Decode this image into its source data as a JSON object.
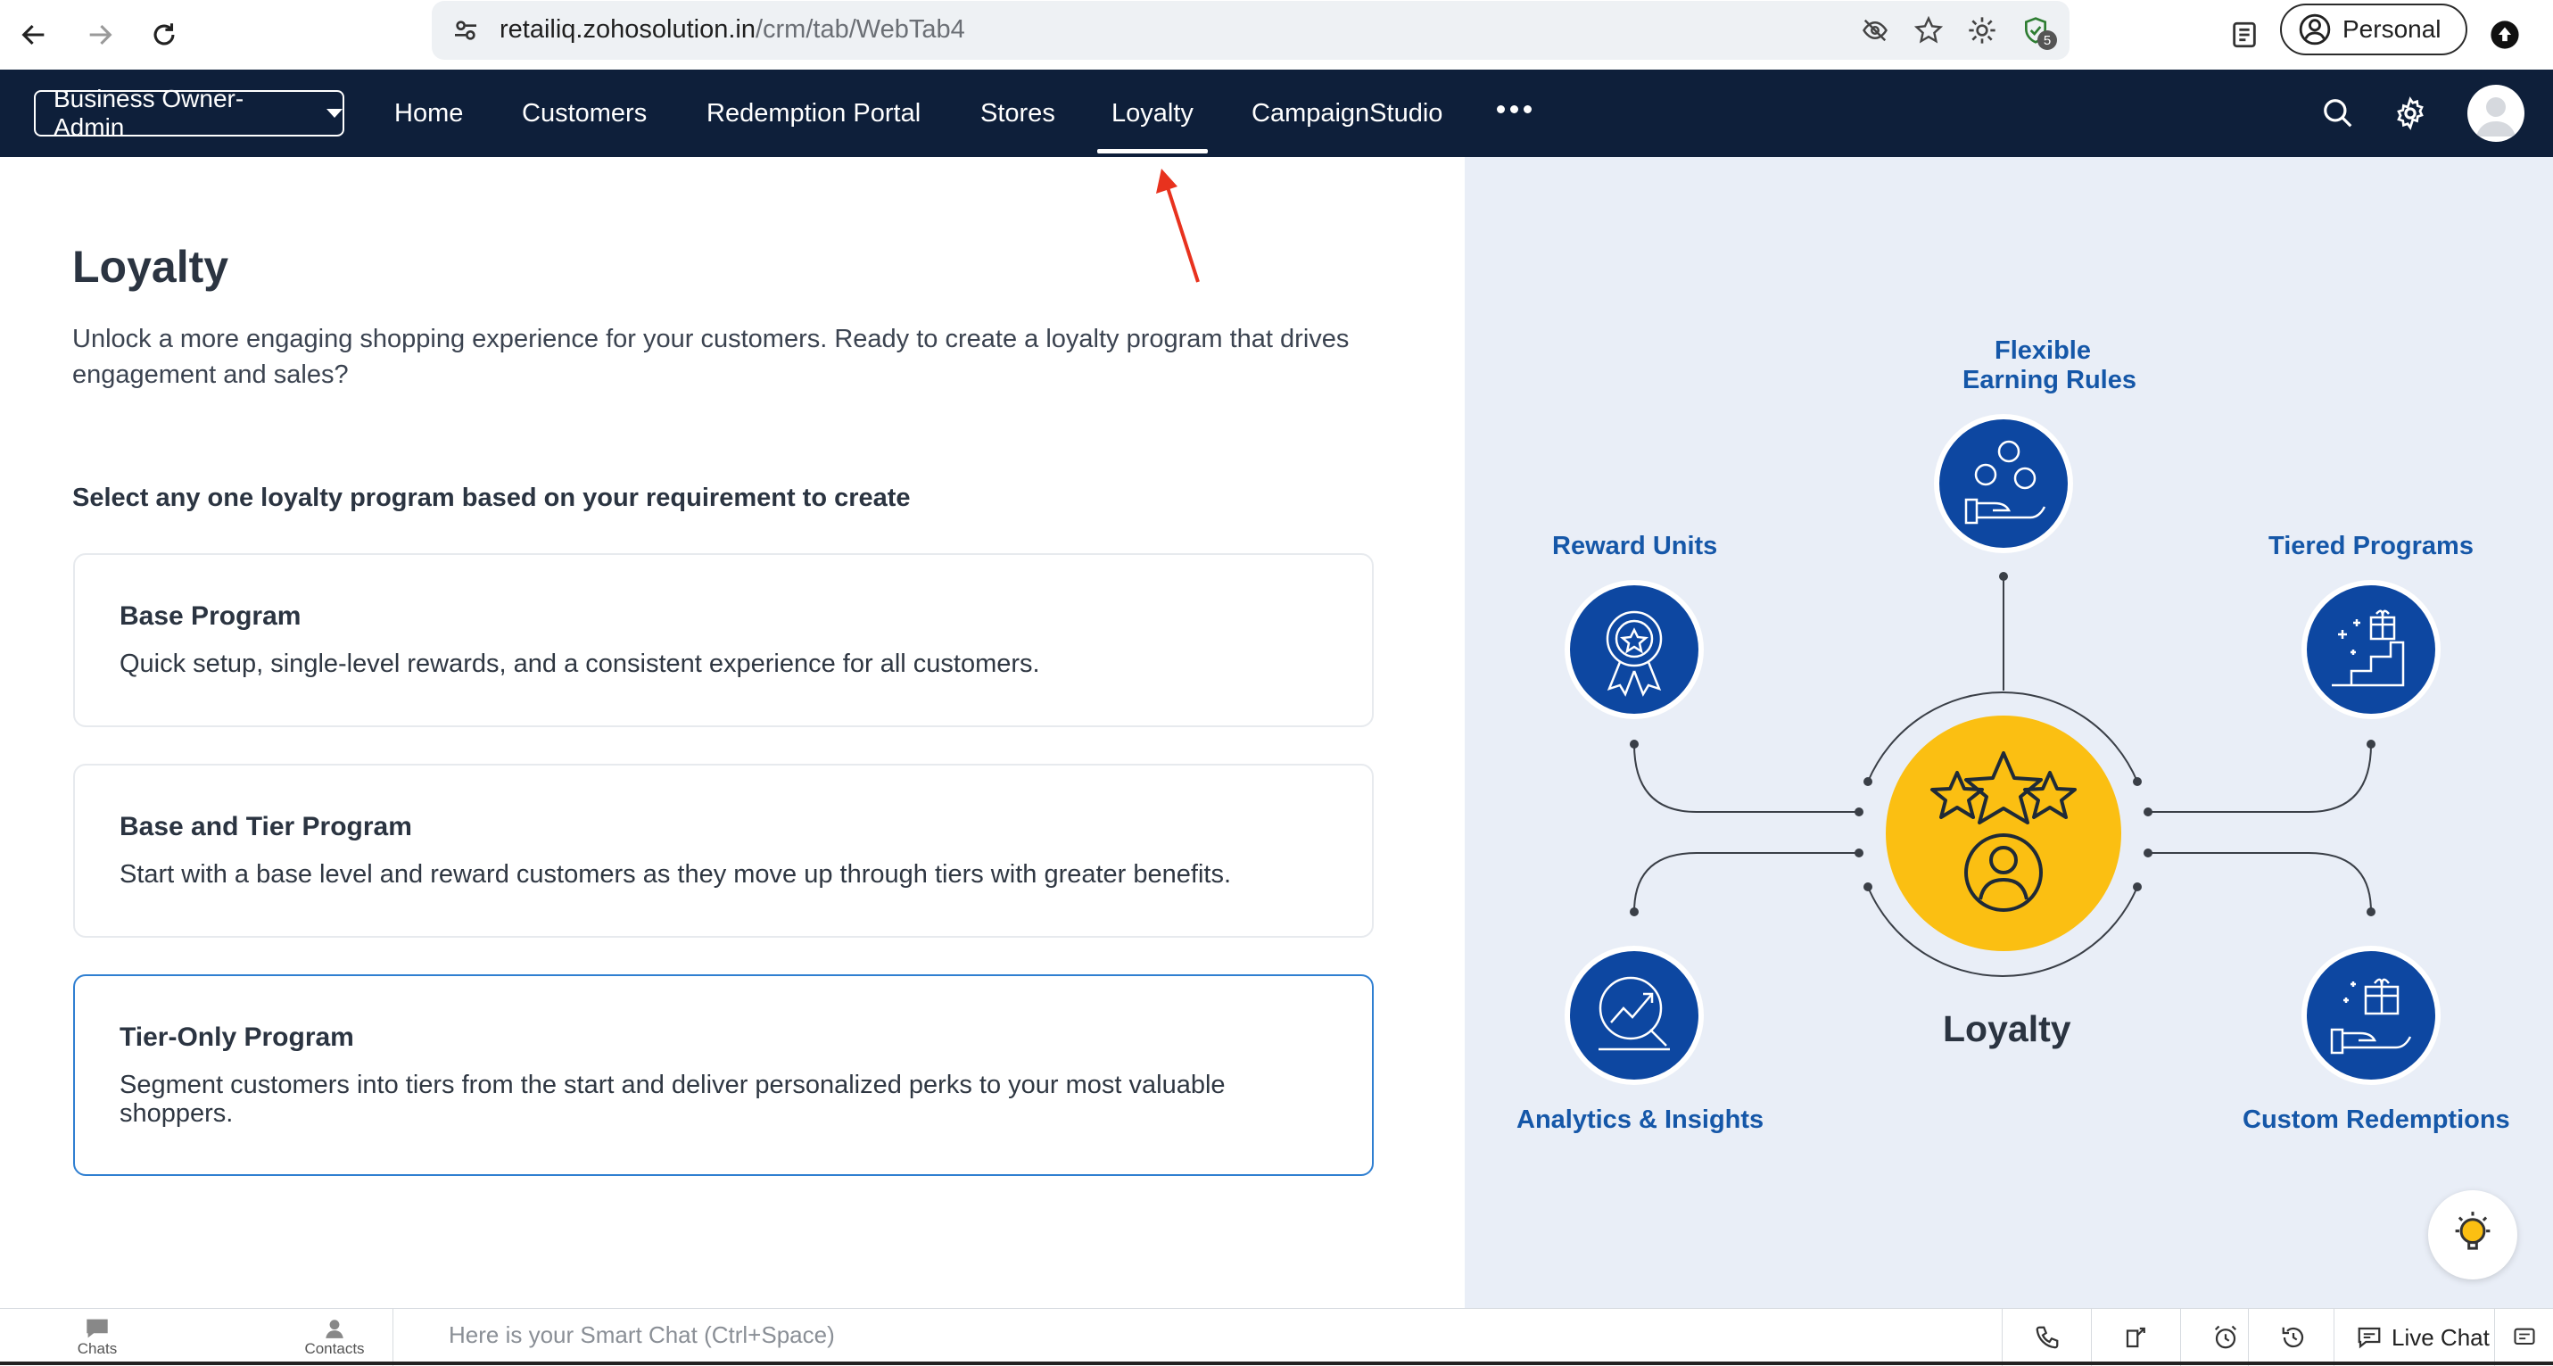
{
  "browser": {
    "url_host": "retailiq.zohosolution.in",
    "url_path": "/crm/tab/WebTab4",
    "extension_badge": "5",
    "profile_label": "Personal",
    "icons": [
      "back-icon",
      "forward-icon",
      "reload-icon",
      "site-settings-icon",
      "eye-off-icon",
      "star-icon",
      "brightness-icon",
      "shield-check-icon",
      "reading-list-icon",
      "profile-icon",
      "update-icon"
    ]
  },
  "nav": {
    "role": "Business Owner-Admin",
    "tabs": [
      {
        "label": "Home"
      },
      {
        "label": "Customers"
      },
      {
        "label": "Redemption Portal"
      },
      {
        "label": "Stores"
      },
      {
        "label": "Loyalty",
        "active": true
      },
      {
        "label": "CampaignStudio"
      }
    ],
    "icons": [
      "more-icon",
      "search-icon",
      "gear-icon",
      "avatar"
    ]
  },
  "main": {
    "title": "Loyalty",
    "description": "Unlock a more engaging shopping experience for your customers. Ready to create a loyalty program that drives engagement and sales?",
    "select_heading": "Select any one loyalty program based on your requirement to create",
    "programs": [
      {
        "title": "Base Program",
        "description": "Quick setup, single-level rewards, and a consistent experience for all customers."
      },
      {
        "title": "Base and Tier Program",
        "description": "Start with a base level and reward customers as they move up through tiers with greater benefits."
      },
      {
        "title": "Tier-Only Program",
        "description": "Segment customers into tiers from the start and deliver personalized perks to your most valuable shoppers.",
        "selected": true
      }
    ]
  },
  "illustration": {
    "center_label": "Loyalty",
    "features": {
      "flexible": {
        "line1": "Flexible",
        "line2": "Earning Rules"
      },
      "reward_units": "Reward Units",
      "tiered": "Tiered Programs",
      "analytics": "Analytics & Insights",
      "redemptions": "Custom Redemptions"
    },
    "colors": {
      "blue": "#0d47a1",
      "gold": "#fbbf12",
      "label_blue": "#1557a8",
      "panel_bg": "#e9eef7"
    }
  },
  "bottom_bar": {
    "chats": "Chats",
    "contacts": "Contacts",
    "smart_chat_placeholder": "Here is your Smart Chat (Ctrl+Space)",
    "live_chat": "Live Chat",
    "tool_icons": [
      "phone-icon",
      "call-transfer-icon",
      "alarm-icon",
      "history-icon",
      "chat-bubble-icon",
      "feedback-icon"
    ]
  },
  "annotation": {
    "arrow_color": "#e8321e"
  }
}
